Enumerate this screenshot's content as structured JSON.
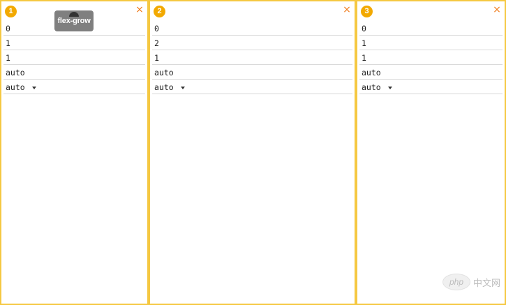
{
  "panels": [
    {
      "number": "1",
      "close_label": "×",
      "fields": [
        "0",
        "1",
        "1",
        "auto",
        "auto"
      ]
    },
    {
      "number": "2",
      "close_label": "×",
      "fields": [
        "0",
        "2",
        "1",
        "auto",
        "auto"
      ]
    },
    {
      "number": "3",
      "close_label": "×",
      "fields": [
        "0",
        "1",
        "1",
        "auto",
        "auto"
      ]
    }
  ],
  "tooltip": {
    "label": "flex-grow"
  },
  "watermark": {
    "logo_text": "php",
    "site_text": "中文网"
  },
  "colors": {
    "panel_border": "#f5c842",
    "badge": "#f2a900",
    "close": "#f07b1a",
    "tooltip_bg": "#7f7f7f"
  }
}
